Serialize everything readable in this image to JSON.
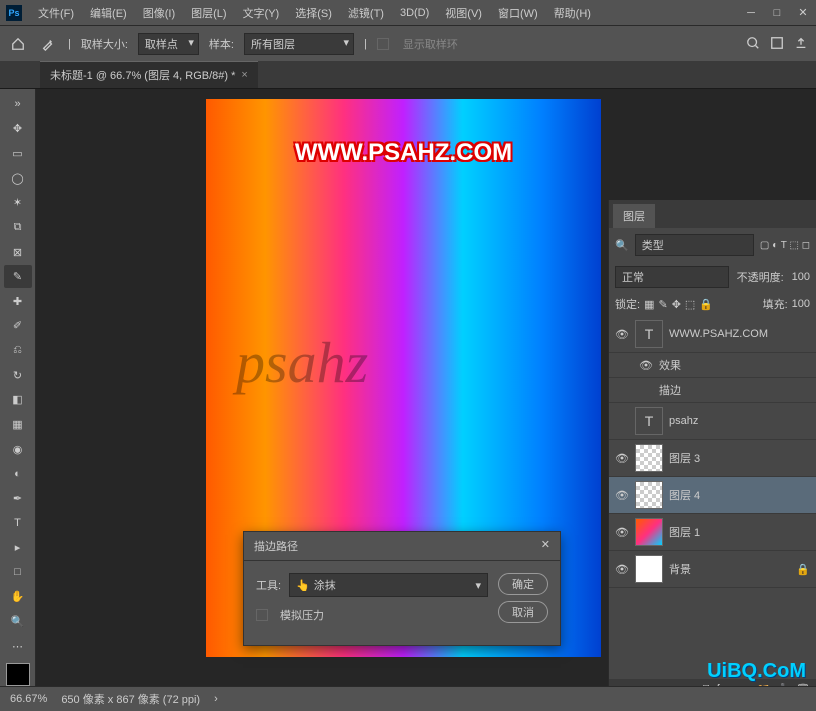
{
  "menubar": {
    "items": [
      "文件(F)",
      "编辑(E)",
      "图像(I)",
      "图层(L)",
      "文字(Y)",
      "选择(S)",
      "滤镜(T)",
      "3D(D)",
      "视图(V)",
      "窗口(W)",
      "帮助(H)"
    ]
  },
  "optionsbar": {
    "sample_size_label": "取样大小:",
    "sample_size_value": "取样点",
    "sample_label": "样本:",
    "sample_value": "所有图层",
    "show_sampling_ring": "显示取样环"
  },
  "document": {
    "tab_title": "未标题-1 @ 66.7% (图层 4, RGB/8#) *"
  },
  "canvas": {
    "text_overlay": "WWW.PSAHZ.COM",
    "script_text": "psahz"
  },
  "dialog": {
    "title": "描边路径",
    "tool_label": "工具:",
    "tool_value": "涂抹",
    "simulate_pressure": "模拟压力",
    "ok": "确定",
    "cancel": "取消"
  },
  "layers_panel": {
    "title": "图层",
    "search_label": "类型",
    "blend_mode": "正常",
    "opacity_label": "不透明度:",
    "opacity_value": "100",
    "lock_label": "锁定:",
    "fill_label": "填充:",
    "fill_value": "100",
    "layers": [
      {
        "name": "WWW.PSAHZ.COM",
        "type": "T",
        "visible": true
      },
      {
        "name": "效果",
        "type": "fx",
        "visible": true,
        "indent": true
      },
      {
        "name": "描边",
        "type": "fx",
        "indent": true
      },
      {
        "name": "psahz",
        "type": "T",
        "visible": false
      },
      {
        "name": "图层 3",
        "type": "checker",
        "visible": true
      },
      {
        "name": "图层 4",
        "type": "checker",
        "visible": true,
        "selected": true
      },
      {
        "name": "图层 1",
        "type": "grad",
        "visible": true
      },
      {
        "name": "背景",
        "type": "white",
        "visible": true
      }
    ]
  },
  "statusbar": {
    "zoom": "66.67%",
    "doc_info": "650 像素 x 867 像素 (72 ppi)"
  },
  "watermark": "UiBQ.CoM"
}
